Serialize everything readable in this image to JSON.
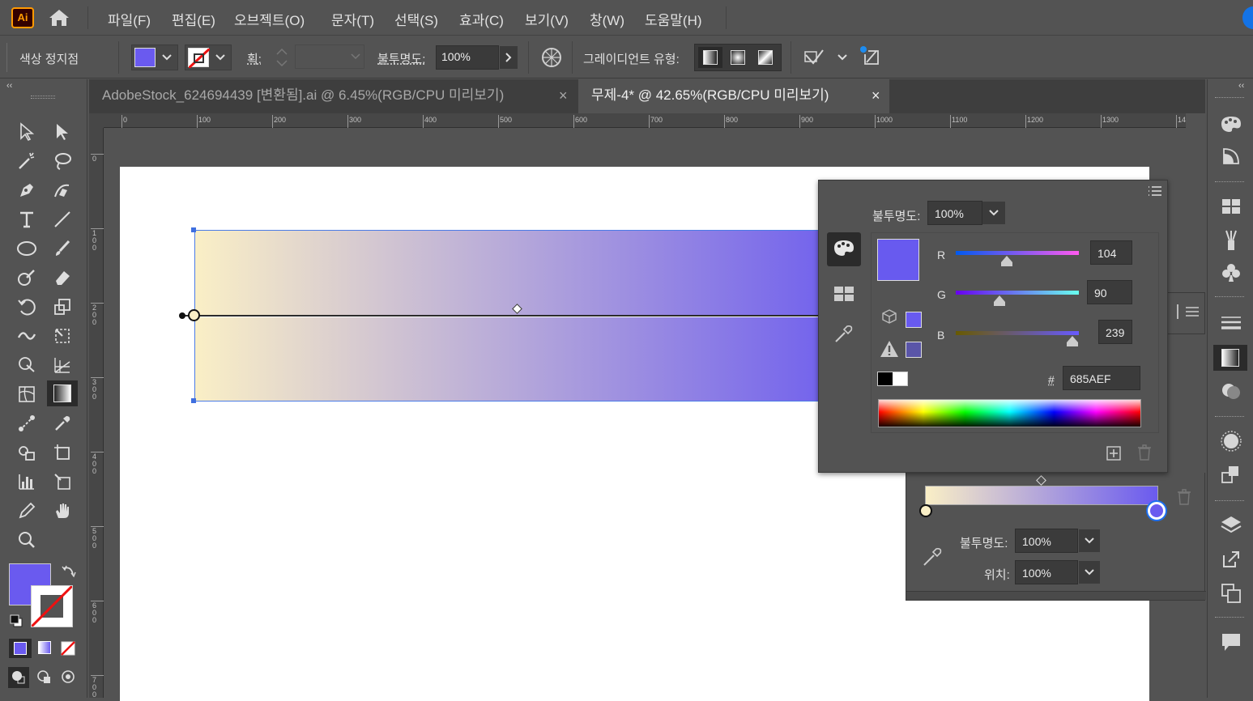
{
  "app": {
    "logo": "Ai"
  },
  "menu": [
    "파일(F)",
    "편집(E)",
    "오브젝트(O)",
    "문자(T)",
    "선택(S)",
    "효과(C)",
    "보기(V)",
    "창(W)",
    "도움말(H)"
  ],
  "control_bar": {
    "mode_label": "색상 정지점",
    "fill_color": "#6a5aef",
    "stroke_label": "획:",
    "opacity_label": "불투명도:",
    "opacity_value": "100%",
    "gradient_type_label": "그레이디언트 유형:"
  },
  "tabs": [
    {
      "label": "AdobeStock_624694439 [변환됨].ai @ 6.45%(RGB/CPU 미리보기)",
      "close": "×",
      "active": false
    },
    {
      "label": "무제-4* @ 42.65%(RGB/CPU 미리보기)",
      "close": "×",
      "active": true
    }
  ],
  "ruler": {
    "top": [
      "0",
      "100",
      "200",
      "300",
      "400",
      "500",
      "600",
      "700",
      "800",
      "900",
      "1000",
      "1100",
      "1200",
      "1300",
      "14"
    ],
    "left": [
      "0",
      "100",
      "200",
      "300",
      "400",
      "500",
      "600",
      "700"
    ]
  },
  "gradient": {
    "start_color": "#faefc6",
    "end_color": "#6a5aef"
  },
  "color_panel": {
    "opacity_label": "불투명도:",
    "opacity_value": "100%",
    "r_label": "R",
    "r_value": "104",
    "r_fraction": 0.41,
    "g_label": "G",
    "g_value": "90",
    "g_fraction": 0.35,
    "b_label": "B",
    "b_value": "239",
    "b_fraction": 0.94,
    "hash_label": "#",
    "hex_value": "685AEF",
    "swatch_color": "#685aef",
    "out_of_gamut_color": "#5a55a8"
  },
  "gradient_panel": {
    "opacity_label": "불투명도:",
    "opacity_value": "100%",
    "position_label": "위치:",
    "position_value": "100%"
  },
  "tool_panel": {
    "fill_color": "#6a5aef"
  }
}
